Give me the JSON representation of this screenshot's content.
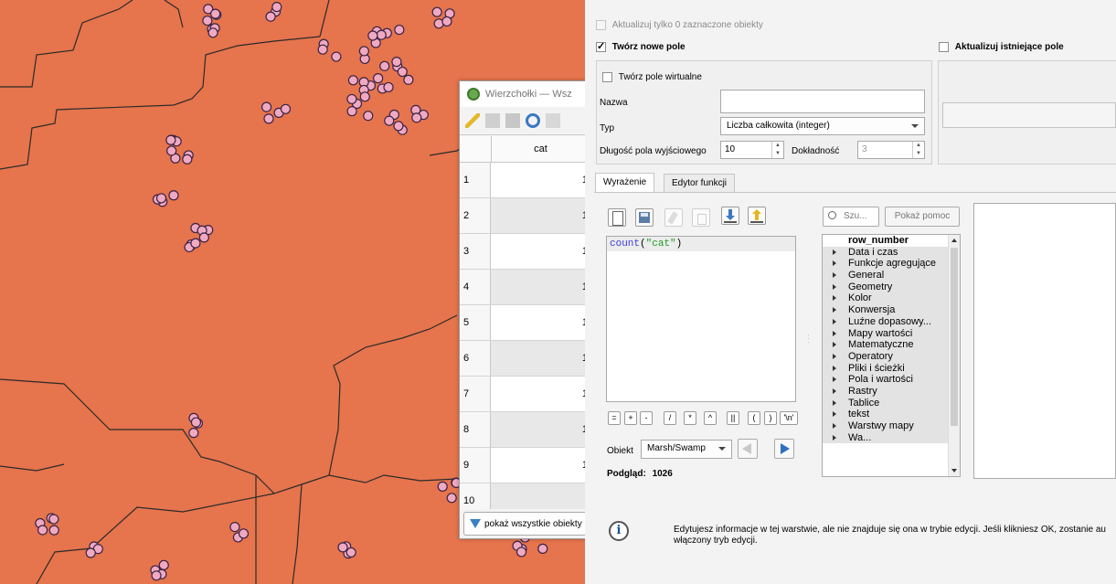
{
  "attribute_table": {
    "title": "Wierzchołki — Wsz",
    "column_header": "cat",
    "rows": [
      {
        "n": "1",
        "v": "1"
      },
      {
        "n": "2",
        "v": "1"
      },
      {
        "n": "3",
        "v": "1"
      },
      {
        "n": "4",
        "v": "1"
      },
      {
        "n": "5",
        "v": "1"
      },
      {
        "n": "6",
        "v": "1"
      },
      {
        "n": "7",
        "v": "1"
      },
      {
        "n": "8",
        "v": "1"
      },
      {
        "n": "9",
        "v": "1"
      },
      {
        "n": "10",
        "v": ""
      }
    ],
    "filter_button": "pokaż wszystkie obiekty"
  },
  "dialog": {
    "update_selected_label": "Aktualizuj tylko 0 zaznaczone obiekty",
    "create_new_field_label": "Twórz nowe pole",
    "update_existing_label": "Aktualizuj istniejące pole",
    "virtual_field_label": "Twórz pole wirtualne",
    "name_label": "Nazwa",
    "name_value": "",
    "type_label": "Typ",
    "type_value": "Liczba całkowita (integer)",
    "length_label": "Długość pola wyjściowego",
    "length_value": "10",
    "precision_label": "Dokładność",
    "precision_value": "3",
    "tabs": [
      "Wyrażenie",
      "Edytor funkcji"
    ],
    "expression_fn": "count",
    "expression_rest_open": "(",
    "expression_str": "\"cat\"",
    "expression_rest_close": ")",
    "operators": [
      "=",
      "+",
      "-",
      "/",
      "*",
      "^",
      "||",
      "(",
      ")",
      "'\\n'"
    ],
    "feature_label": "Obiekt",
    "feature_value": "Marsh/Swamp",
    "preview_label": "Podgląd:",
    "preview_value": "1026",
    "search_placeholder": "Szu...",
    "show_help_button": "Pokaż pomoc",
    "function_tree": [
      "row_number",
      "Data i czas",
      "Funkcje agregujące",
      "General",
      "Geometry",
      "Kolor",
      "Konwersja",
      "Luźne dopasowy...",
      "Mapy wartości",
      "Matematyczne",
      "Operatory",
      "Pliki i ścieżki",
      "Pola i wartości",
      "Rastry",
      "Tablice",
      "tekst",
      "Warstwy mapy",
      "Wa..."
    ],
    "info_line1": "Edytujesz informacje w tej warstwie, ale nie znajduje się ona w trybie edycji. Jeśli klikniesz OK, zostanie au",
    "info_line2": "włączony tryb edycji."
  }
}
